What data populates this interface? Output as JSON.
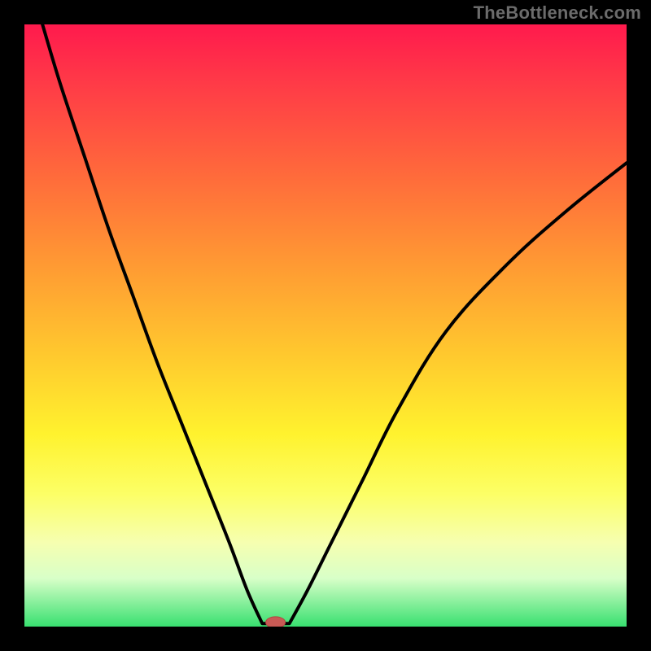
{
  "watermark": "TheBottleneck.com",
  "colors": {
    "curve_stroke": "#000000",
    "marker_fill": "#c85a55"
  },
  "chart_data": {
    "type": "line",
    "title": "",
    "xlabel": "",
    "ylabel": "",
    "xlim": [
      0,
      100
    ],
    "ylim": [
      0,
      100
    ],
    "grid": false,
    "legend": false,
    "series": [
      {
        "name": "curve-left",
        "x": [
          3,
          6,
          10,
          14,
          18,
          22,
          26,
          30,
          34,
          37,
          39.5
        ],
        "y": [
          100,
          90,
          78,
          66,
          55,
          44,
          34,
          24,
          14,
          6,
          0.5
        ]
      },
      {
        "name": "curve-right",
        "x": [
          44,
          47,
          51,
          56,
          62,
          70,
          80,
          90,
          100
        ],
        "y": [
          0.5,
          6,
          14,
          24,
          36,
          49,
          60,
          69,
          77
        ]
      }
    ],
    "marker": {
      "x": 41.7,
      "y": 0.7
    },
    "flat_bottom": {
      "x_start": 39.5,
      "x_end": 44,
      "y": 0.5
    }
  }
}
